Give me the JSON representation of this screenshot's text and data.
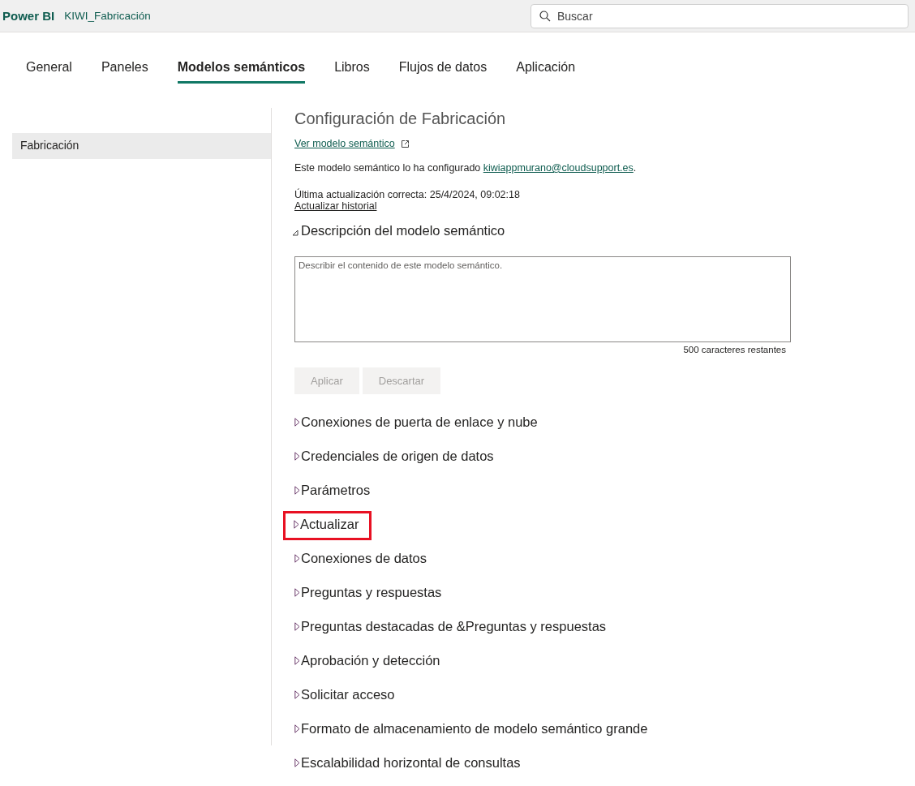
{
  "header": {
    "brand": "Power BI",
    "workspace": "KIWI_Fabricación",
    "search": {
      "placeholder": "Buscar"
    }
  },
  "tabs": [
    {
      "label": "General",
      "selected": false
    },
    {
      "label": "Paneles",
      "selected": false
    },
    {
      "label": "Modelos semánticos",
      "selected": true
    },
    {
      "label": "Libros",
      "selected": false
    },
    {
      "label": "Flujos de datos",
      "selected": false
    },
    {
      "label": "Aplicación",
      "selected": false
    }
  ],
  "sidebar": {
    "items": [
      {
        "label": "Fabricación",
        "selected": true
      }
    ]
  },
  "settings": {
    "title": "Configuración de Fabricación",
    "view_link": "Ver modelo semántico",
    "configured_by": {
      "text": "Este modelo semántico lo ha configurado ",
      "email": "kiwiappmurano@cloudsupport.es",
      "end": "."
    },
    "last_refresh": "Última actualización correcta: 25/4/2024, 09:02:18",
    "history_link": "Actualizar historial",
    "description": {
      "heading": "Descripción del modelo semántico",
      "expanded": true,
      "placeholder": "Describir el contenido de este modelo semántico.",
      "remaining": "500 caracteres restantes",
      "buttons": [
        {
          "label": "Aplicar",
          "disabled": true
        },
        {
          "label": "Descartar",
          "disabled": true
        }
      ]
    },
    "sections": [
      {
        "heading": "Conexiones de puerta de enlace y nube",
        "expanded": false,
        "highlighted": false
      },
      {
        "heading": "Credenciales de origen de datos",
        "expanded": false,
        "highlighted": false
      },
      {
        "heading": "Parámetros",
        "expanded": false,
        "highlighted": false
      },
      {
        "heading": "Actualizar",
        "expanded": false,
        "highlighted": true
      },
      {
        "heading": "Conexiones de datos",
        "expanded": false,
        "highlighted": false
      },
      {
        "heading": "Preguntas y respuestas",
        "expanded": false,
        "highlighted": false
      },
      {
        "heading": "Preguntas destacadas de &Preguntas y respuestas",
        "expanded": false,
        "highlighted": false
      },
      {
        "heading": "Aprobación y detección",
        "expanded": false,
        "highlighted": false
      },
      {
        "heading": "Solicitar acceso",
        "expanded": false,
        "highlighted": false
      },
      {
        "heading": "Formato de almacenamiento de modelo semántico grande",
        "expanded": false,
        "highlighted": false
      },
      {
        "heading": "Escalabilidad horizontal de consultas",
        "expanded": false,
        "highlighted": false
      }
    ]
  }
}
